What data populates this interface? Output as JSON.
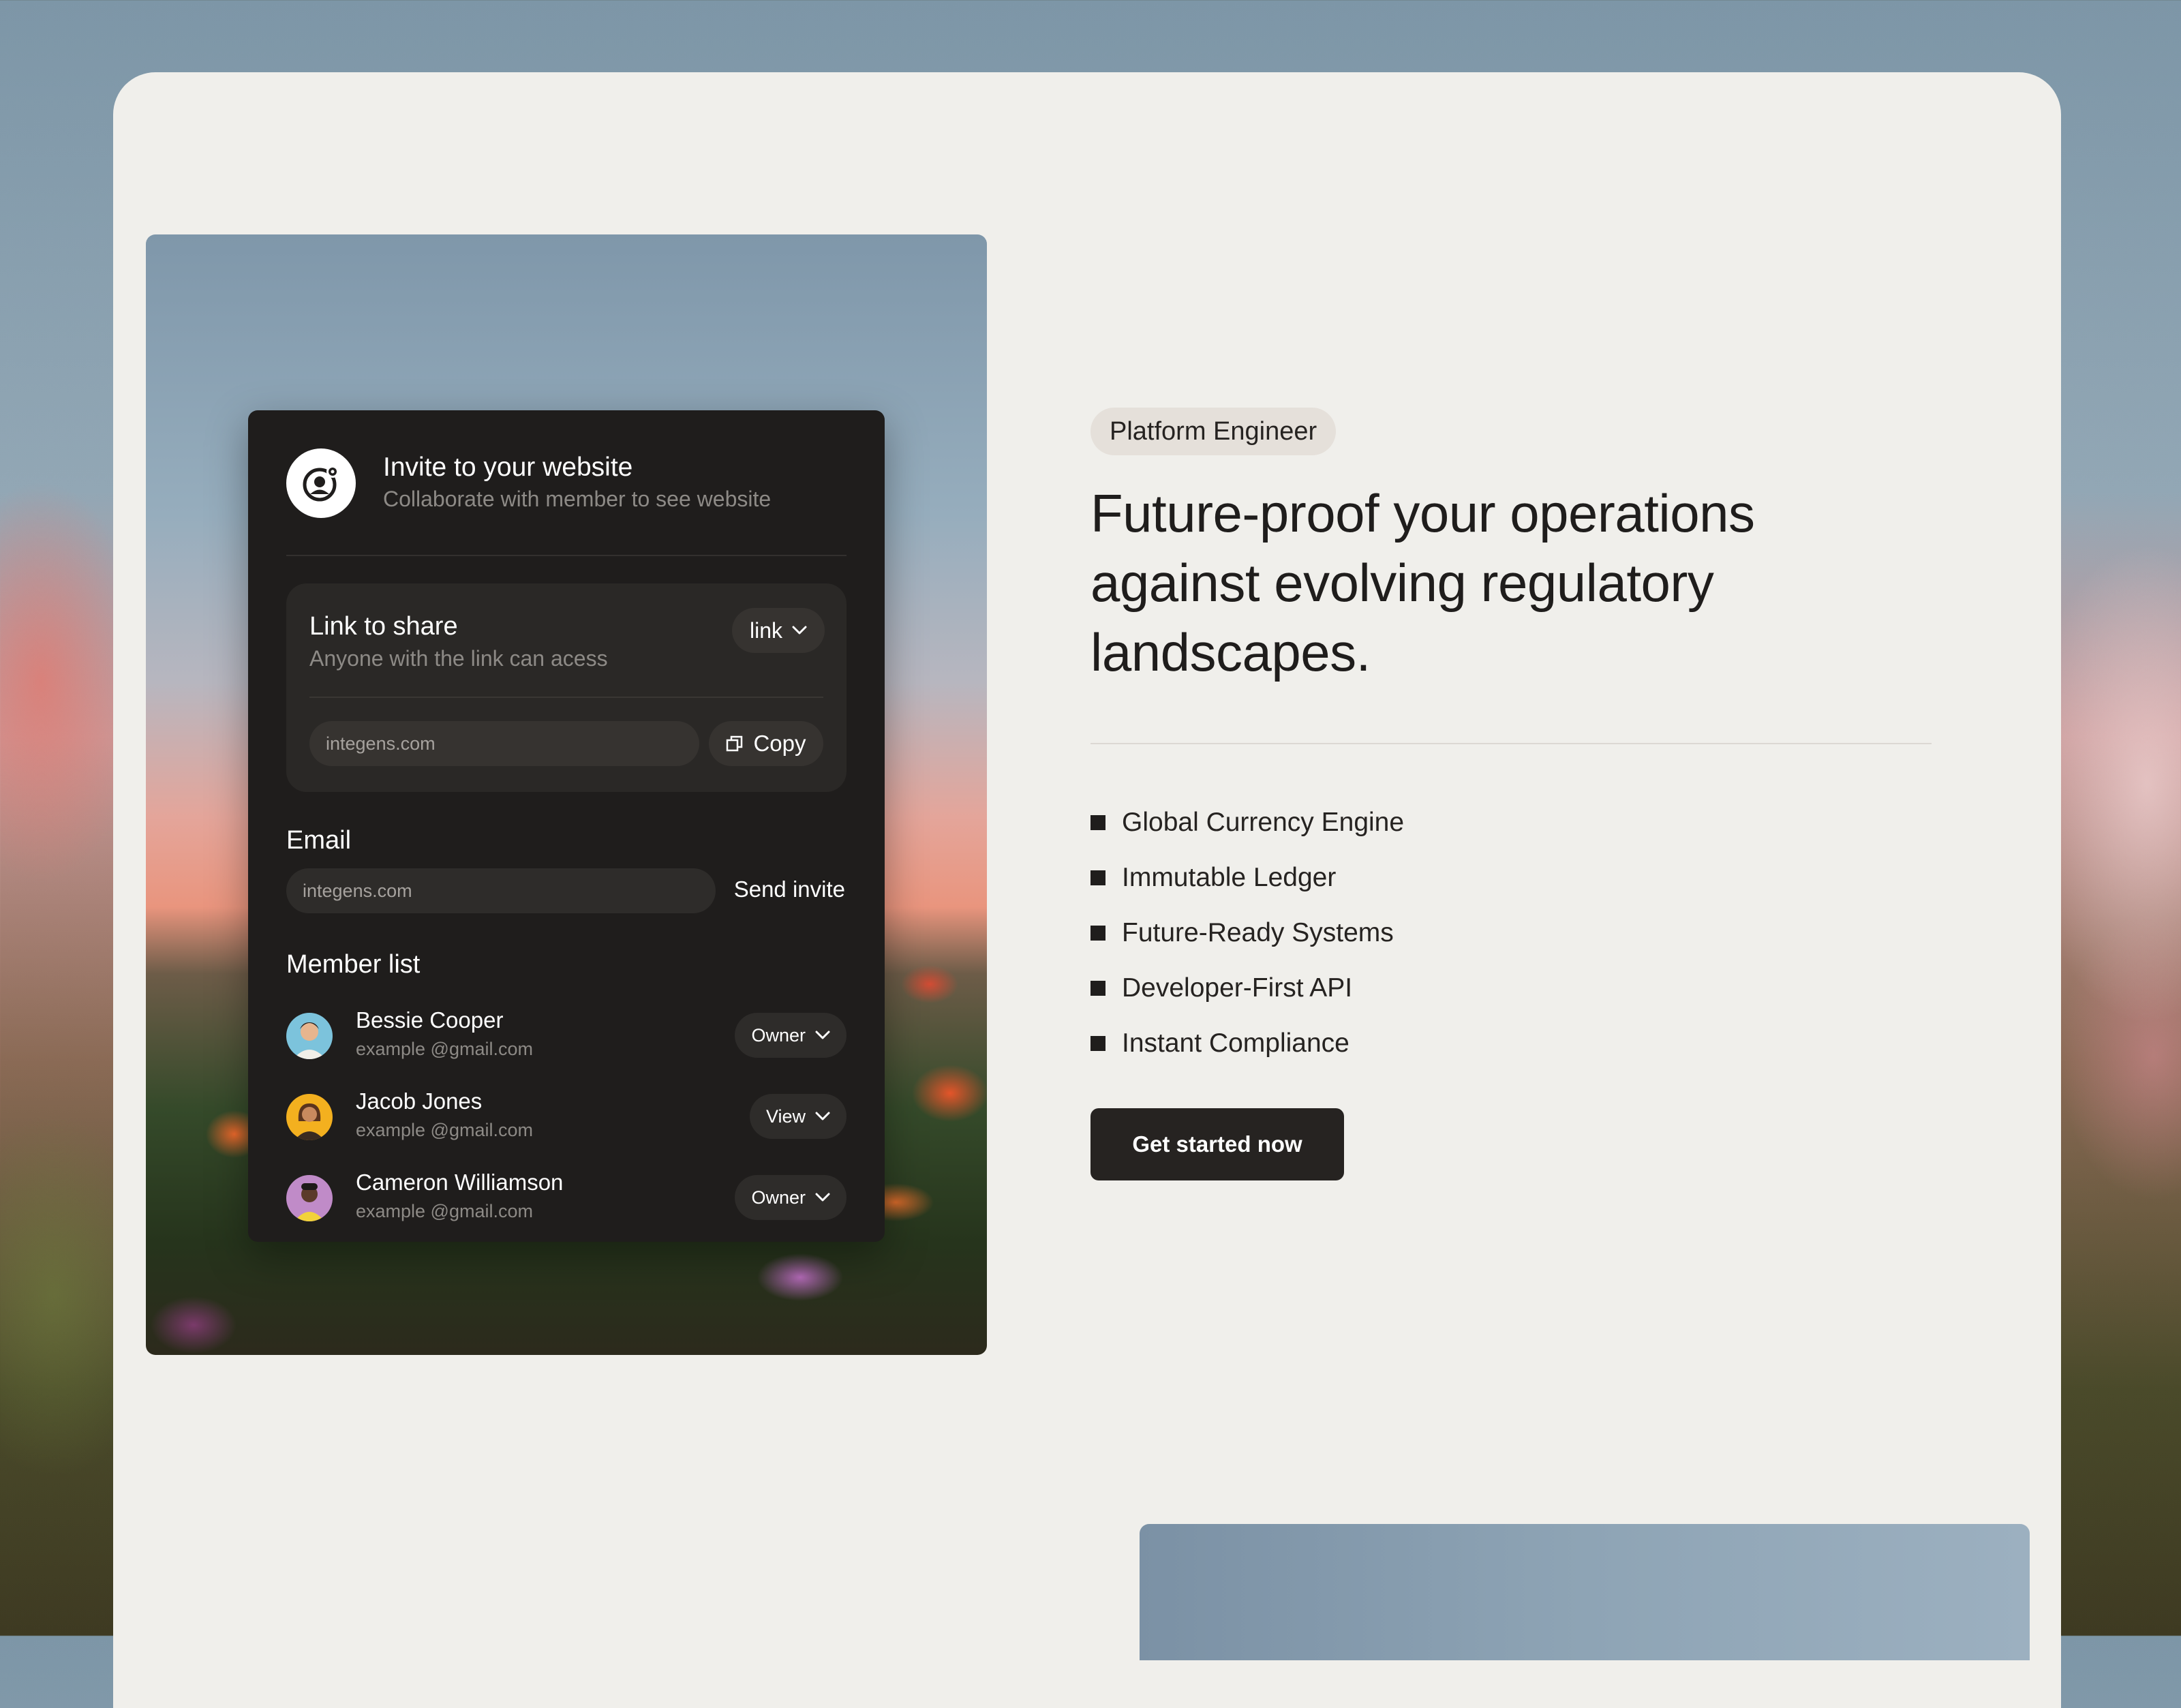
{
  "invite": {
    "title": "Invite to your website",
    "subtitle": "Collaborate with member to see website",
    "share": {
      "title": "Link to share",
      "subtitle": "Anyone with the link can acess",
      "select_value": "link",
      "url_value": "integens.com",
      "copy_label": "Copy"
    },
    "email": {
      "label": "Email",
      "value": "integens.com",
      "send_label": "Send invite"
    },
    "members": {
      "label": "Member list",
      "items": [
        {
          "name": "Bessie Cooper",
          "email": "example @gmail.com",
          "role": "Owner"
        },
        {
          "name": "Jacob Jones",
          "email": "example @gmail.com",
          "role": "View"
        },
        {
          "name": "Cameron Williamson",
          "email": "example @gmail.com",
          "role": "Owner"
        }
      ]
    }
  },
  "hero": {
    "tag": "Platform Engineer",
    "headline": "Future-proof your operations against evolving regulatory landscapes.",
    "features": [
      "Global Currency Engine",
      "Immutable Ledger",
      "Future-Ready Systems",
      "Developer-First API",
      "Instant Compliance"
    ],
    "cta_label": "Get started now"
  },
  "icons": {
    "logo": "user-gear-icon",
    "copy": "copy-icon",
    "dropdown": "chevron-down-icon",
    "bullet": "square-bullet-icon"
  },
  "colors": {
    "page_bg": "#f0efeb",
    "dark_panel": "#1f1d1c",
    "cta_bg": "#262321",
    "tag_bg": "#e5e0da"
  }
}
